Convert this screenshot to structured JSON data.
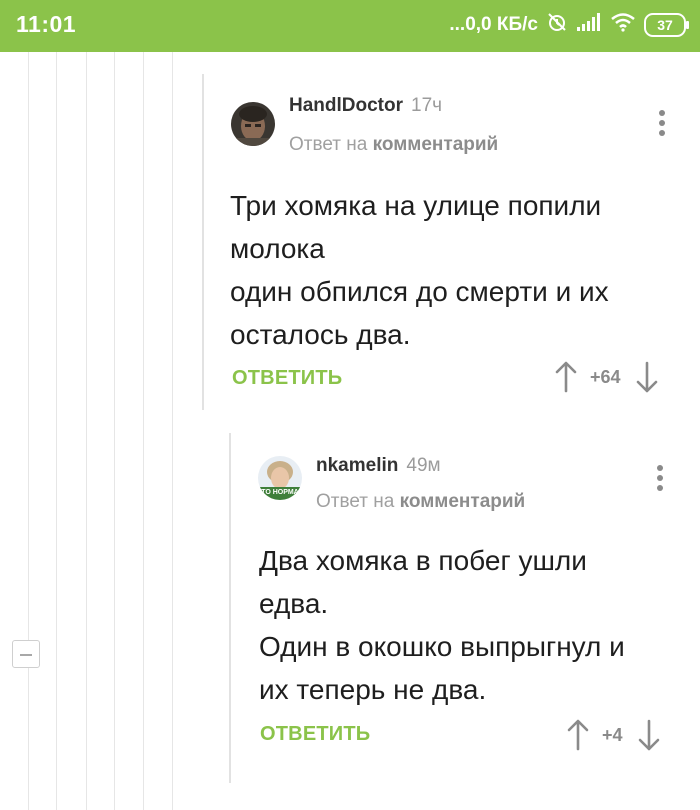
{
  "status_bar": {
    "time": "11:01",
    "network_speed": "...0,0 КБ/с",
    "battery_level": "37",
    "icons": [
      "alarm-off-icon",
      "signal-icon",
      "wifi-icon",
      "battery-icon"
    ]
  },
  "colors": {
    "accent": "#8bc34a",
    "text": "#1e1e1e",
    "muted": "#9b9b9b"
  },
  "comments": [
    {
      "author": "HandlDoctor",
      "time_ago": "17ч",
      "reply_prefix": "Ответ на",
      "reply_target": "комментарий",
      "text_lines": [
        "Три хомяка на улице попили",
        "молока",
        "один обпился до смерти и их",
        "осталось два."
      ],
      "reply_label": "ОТВЕТИТЬ",
      "score": "+64"
    },
    {
      "author": "nkamelin",
      "time_ago": "49м",
      "reply_prefix": "Ответ на",
      "reply_target": "комментарий",
      "avatar_caption": "ТО НОРМА",
      "text_lines": [
        "Два хомяка в побег ушли",
        "едва.",
        "Один в окошко выпрыгнул и",
        "их теперь не два."
      ],
      "reply_label": "ОТВЕТИТЬ",
      "score": "+4"
    }
  ]
}
